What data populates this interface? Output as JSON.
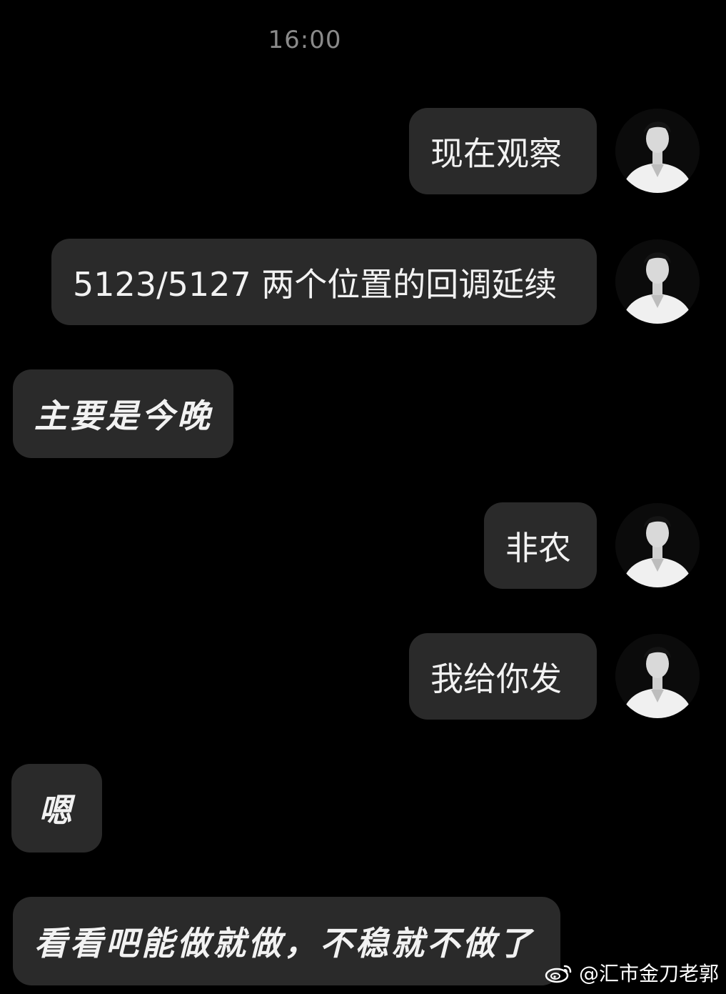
{
  "chat": {
    "timestamp": "16:00",
    "messages": [
      {
        "side": "right",
        "text": "现在观察"
      },
      {
        "side": "right",
        "text": "5123/5127 两个位置的回调延续"
      },
      {
        "side": "left",
        "text": "主要是今晚"
      },
      {
        "side": "right",
        "text": "非农"
      },
      {
        "side": "right",
        "text": "我给你发"
      },
      {
        "side": "left",
        "text": "嗯"
      },
      {
        "side": "left",
        "text": "看看吧能做就做，不稳就不做了"
      }
    ]
  },
  "watermark": {
    "text": "@汇市金刀老郭",
    "icon": "weibo-icon"
  },
  "colors": {
    "background": "#000000",
    "bubble": "#2a2a2a",
    "text": "#f2f2f2",
    "timestamp": "#8a8a8a"
  }
}
